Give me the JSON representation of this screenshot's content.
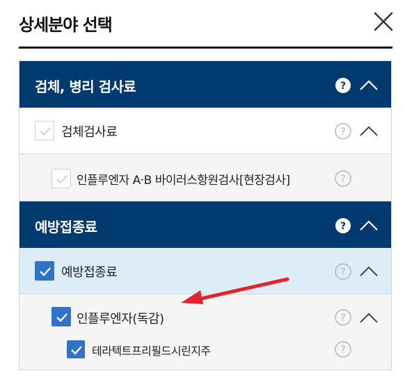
{
  "dialog": {
    "title": "상세분야 선택",
    "close_icon": "close-icon"
  },
  "sections": [
    {
      "label": "검체, 병리 검사료",
      "expanded": true,
      "items": [
        {
          "label": "검체검사료",
          "checked": false,
          "expanded": true,
          "children": [
            {
              "label": "인플루엔자 A·B 바이러스항원검사[현장검사]",
              "checked": false
            }
          ]
        }
      ]
    },
    {
      "label": "예방접종료",
      "expanded": true,
      "items": [
        {
          "label": "예방접종료",
          "checked": true,
          "expanded": true,
          "children": [
            {
              "label": "인플루엔자(독감)",
              "checked": true,
              "expanded": true,
              "children": [
                {
                  "label": "테라텍트프리필드시린지주",
                  "checked": true
                }
              ]
            }
          ]
        }
      ]
    }
  ],
  "colors": {
    "section_bg": "#003a6f",
    "selected_row_bg": "#dcedf8",
    "checked_bg": "#2e73c9",
    "annotation_arrow": "#e4232b"
  }
}
